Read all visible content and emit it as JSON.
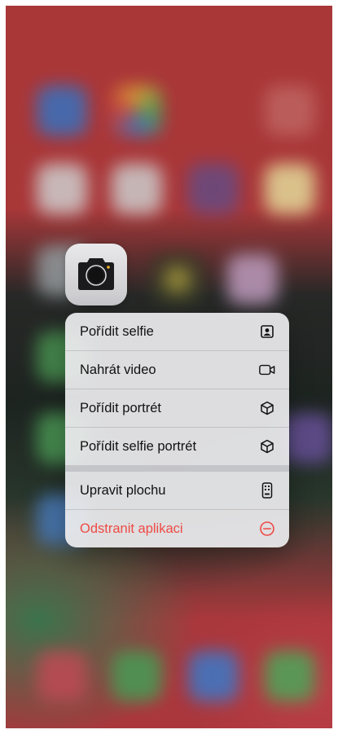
{
  "app_icon": {
    "name": "camera-icon"
  },
  "menu": {
    "group1": [
      {
        "label": "Pořídit selfie",
        "icon": "portrait-selfie-icon"
      },
      {
        "label": "Nahrát video",
        "icon": "video-camera-icon"
      },
      {
        "label": "Pořídit portrét",
        "icon": "cube-icon"
      },
      {
        "label": "Pořídit selfie portrét",
        "icon": "cube-icon"
      }
    ],
    "group2": [
      {
        "label": "Upravit plochu",
        "icon": "phone-home-screen-icon"
      },
      {
        "label": "Odstranit aplikaci",
        "icon": "minus-circle-icon"
      }
    ]
  },
  "colors": {
    "destructive": "#ee4a45",
    "menu_background": "#ececee",
    "wallpaper_red": "#b43a3b"
  }
}
